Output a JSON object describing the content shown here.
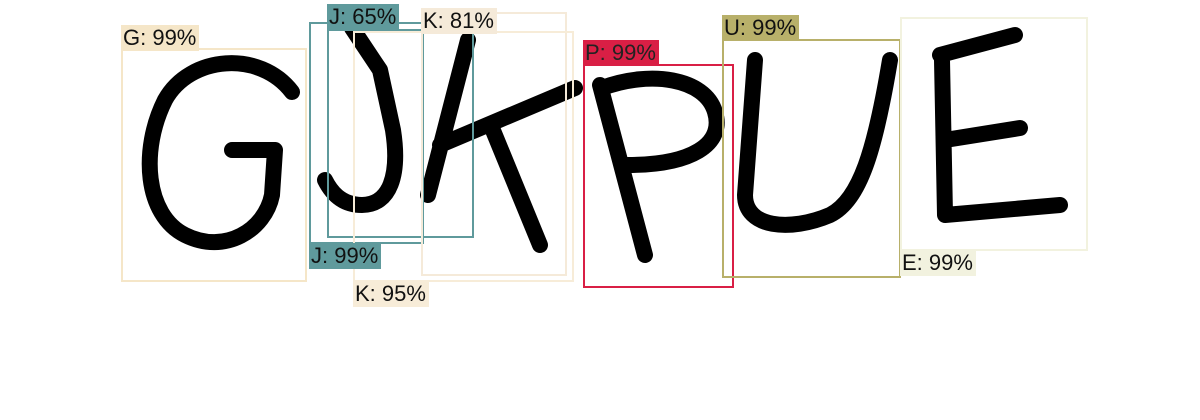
{
  "detections": [
    {
      "id": "g",
      "letter": "G",
      "label": "G: 99%",
      "score": 99,
      "color": "#f5e6c8",
      "text_color": "#111111"
    },
    {
      "id": "j1",
      "letter": "J",
      "label": "J: 65%",
      "score": 65,
      "color": "#5f9a9c",
      "text_color": "#111111"
    },
    {
      "id": "j2",
      "letter": "J",
      "label": "J: 99%",
      "score": 99,
      "color": "#5f9a9c",
      "text_color": "#111111"
    },
    {
      "id": "k1",
      "letter": "K",
      "label": "K: 81%",
      "score": 81,
      "color": "#f5ead9",
      "text_color": "#111111"
    },
    {
      "id": "k2",
      "letter": "K",
      "label": "K: 95%",
      "score": 95,
      "color": "#f7ecd8",
      "text_color": "#111111"
    },
    {
      "id": "p",
      "letter": "P",
      "label": "P: 99%",
      "score": 99,
      "color": "#d91f45",
      "text_color": "#222222"
    },
    {
      "id": "u",
      "letter": "U",
      "label": "U: 99%",
      "score": 99,
      "color": "#b8b06a",
      "text_color": "#111111"
    },
    {
      "id": "e",
      "letter": "E",
      "label": "E: 99%",
      "score": 99,
      "color": "#f2f2df",
      "text_color": "#111111"
    }
  ]
}
